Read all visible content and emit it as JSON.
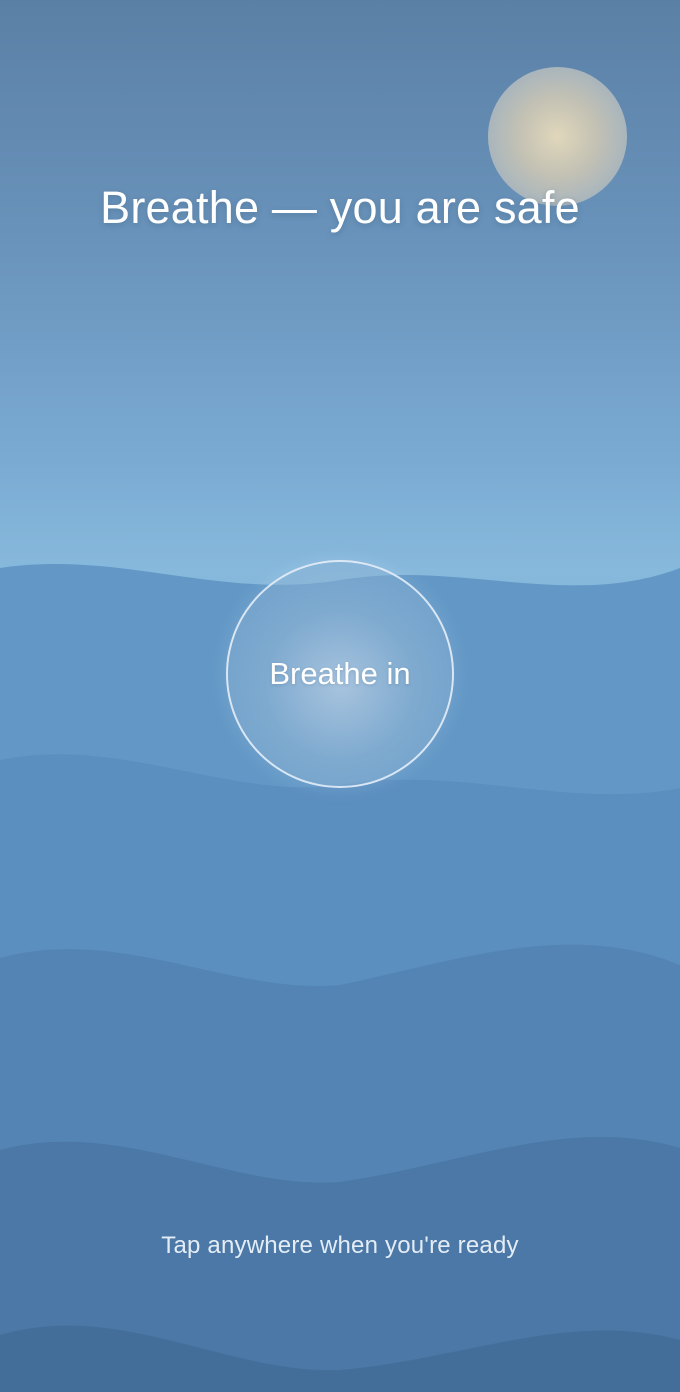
{
  "screen": {
    "headline": "Breathe — you are safe",
    "breath_prompt": "Breathe in",
    "tap_hint": "Tap anywhere when you're ready"
  },
  "colors": {
    "sky_top": "#5b80a6",
    "sky_mid": "#87b9dc",
    "wave_light": "#6398c8",
    "wave_deep": "#456f9c",
    "sun_core": "#e7dbbb",
    "text": "#ffffff"
  }
}
